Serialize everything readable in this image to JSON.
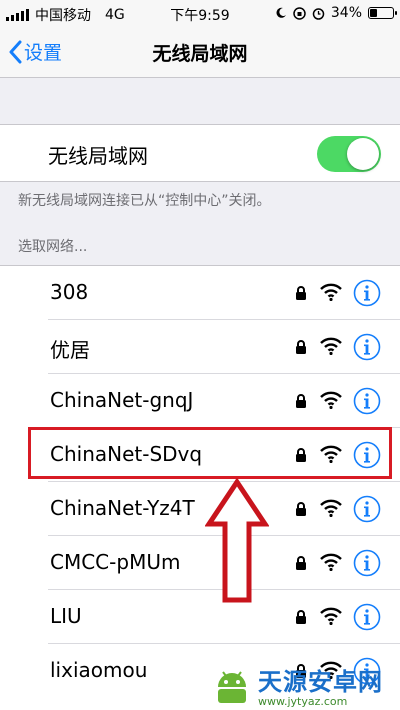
{
  "status_bar": {
    "carrier": "中国移动",
    "network": "4G",
    "time": "下午9:59",
    "battery": "34%",
    "battery_level": 0.34
  },
  "nav": {
    "back_label": "设置",
    "title": "无线局域网"
  },
  "wifi_toggle": {
    "label": "无线局域网",
    "on": true
  },
  "note": "新无线局域网连接已从“控制中心”关闭。",
  "choose_network": "选取网络...",
  "networks": [
    {
      "name": "308"
    },
    {
      "name": "优居"
    },
    {
      "name": "ChinaNet-gnqJ"
    },
    {
      "name": "ChinaNet-SDvq"
    },
    {
      "name": "ChinaNet-Yz4T"
    },
    {
      "name": "CMCC-pMUm"
    },
    {
      "name": "LIU"
    },
    {
      "name": "lixiaomou"
    }
  ],
  "colors": {
    "accent": "#147efb",
    "toggle_on": "#4cd964",
    "highlight": "#d81b24"
  },
  "watermark": {
    "name": "天源安卓网",
    "url": "www.jytyaz.com"
  }
}
